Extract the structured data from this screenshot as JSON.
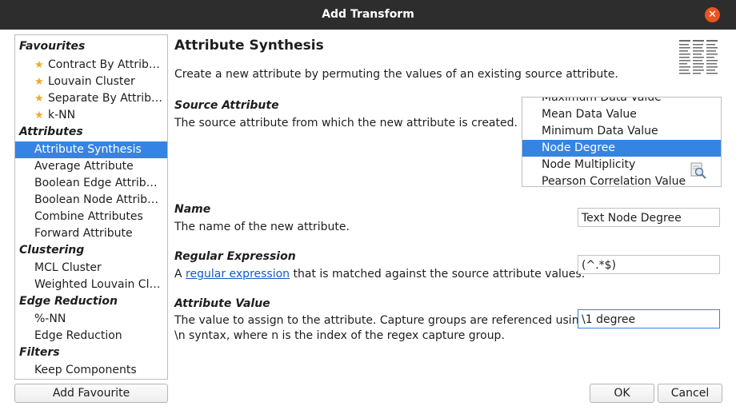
{
  "window": {
    "title": "Add Transform"
  },
  "sidebar": {
    "categories": [
      {
        "label": "Favourites",
        "items": [
          {
            "label": "Contract By Attrib…",
            "favourite": true
          },
          {
            "label": "Louvain Cluster",
            "favourite": true
          },
          {
            "label": "Separate By Attrib…",
            "favourite": true
          },
          {
            "label": "k-NN",
            "favourite": true
          }
        ]
      },
      {
        "label": "Attributes",
        "items": [
          {
            "label": "Attribute Synthesis",
            "selected": true
          },
          {
            "label": "Average Attribute"
          },
          {
            "label": "Boolean Edge Attrib…"
          },
          {
            "label": "Boolean Node Attrib…"
          },
          {
            "label": "Combine Attributes"
          },
          {
            "label": "Forward Attribute"
          }
        ]
      },
      {
        "label": "Clustering",
        "items": [
          {
            "label": "MCL Cluster"
          },
          {
            "label": "Weighted Louvain Cl…"
          }
        ]
      },
      {
        "label": "Edge Reduction",
        "items": [
          {
            "label": "%-NN"
          },
          {
            "label": "Edge Reduction"
          }
        ]
      },
      {
        "label": "Filters",
        "items": [
          {
            "label": "Keep Components"
          }
        ]
      }
    ],
    "add_favourite_label": "Add Favourite"
  },
  "main": {
    "heading": "Attribute Synthesis",
    "description": "Create a new attribute by permuting the values of an existing source attribute.",
    "source": {
      "title": "Source Attribute",
      "description": "The source attribute from which the new attribute is created.",
      "options": [
        "Maximum Data Value",
        "Mean Data Value",
        "Minimum Data Value",
        "Node Degree",
        "Node Multiplicity",
        "Pearson Correlation Value"
      ],
      "selected": "Node Degree"
    },
    "name": {
      "title": "Name",
      "description": "The name of the new attribute.",
      "value": "Text Node Degree"
    },
    "regex": {
      "title": "Regular Expression",
      "desc_prefix": "A",
      "link_text": "regular expression",
      "desc_suffix": "that is matched against the source attribute values.",
      "value": "(^.*$)"
    },
    "attribute_value": {
      "title": "Attribute Value",
      "description_line1": "The value to assign to the attribute. Capture groups are referenced using",
      "description_line2": "\\n syntax, where n is the index of the regex capture group.",
      "value": "\\1 degree"
    }
  },
  "footer": {
    "ok_label": "OK",
    "cancel_label": "Cancel"
  },
  "colors": {
    "selection": "#3584e4",
    "titlebar": "#2d2d2d",
    "close_button": "#e9541f",
    "star": "#f0a92a",
    "link": "#1a56c9"
  },
  "icons": {
    "close": "close-icon",
    "star": "star-icon",
    "help_doc": "document-icon",
    "search": "search-icon"
  }
}
